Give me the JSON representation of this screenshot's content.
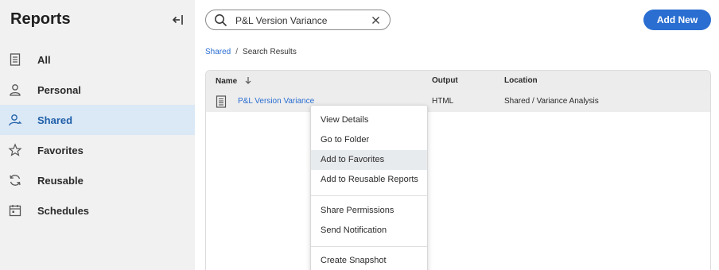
{
  "sidebar": {
    "title": "Reports",
    "items": [
      {
        "label": "All",
        "icon": "document-icon",
        "active": false
      },
      {
        "label": "Personal",
        "icon": "user-icon",
        "active": false
      },
      {
        "label": "Shared",
        "icon": "shared-user-icon",
        "active": true
      },
      {
        "label": "Favorites",
        "icon": "star-icon",
        "active": false
      },
      {
        "label": "Reusable",
        "icon": "refresh-icon",
        "active": false
      },
      {
        "label": "Schedules",
        "icon": "calendar-icon",
        "active": false
      }
    ]
  },
  "search": {
    "value": "P&L Version Variance"
  },
  "header": {
    "add_new_label": "Add New",
    "accent_color": "#2a6ed1"
  },
  "breadcrumb": {
    "root": "Shared",
    "separator": "/",
    "current": "Search Results"
  },
  "table": {
    "columns": {
      "name": "Name",
      "output": "Output",
      "location": "Location"
    },
    "rows": [
      {
        "name": "P&L Version Variance",
        "output": "HTML",
        "location": "Shared / Variance Analysis"
      }
    ]
  },
  "context_menu": {
    "groups": [
      [
        "View Details",
        "Go to Folder",
        "Add to Favorites",
        "Add to Reusable Reports"
      ],
      [
        "Share Permissions",
        "Send Notification"
      ],
      [
        "Create Snapshot"
      ]
    ],
    "hovered": "Add to Favorites"
  }
}
